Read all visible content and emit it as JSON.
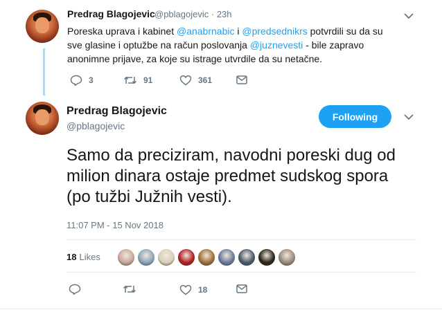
{
  "tweet1": {
    "name": "Predrag Blagojevic",
    "handle": "@pblagojevic",
    "time": "· 23h",
    "text_parts": [
      {
        "text": "Poreska uprava i kabinet ",
        "mention": false
      },
      {
        "text": "@anabrnabic",
        "mention": true
      },
      {
        "text": " i ",
        "mention": false
      },
      {
        "text": "@predsednikrs",
        "mention": true
      },
      {
        "text": " potvrdili su da su sve glasine i optužbe na račun poslovanja ",
        "mention": false
      },
      {
        "text": "@juznevesti",
        "mention": true
      },
      {
        "text": " - bile zapravo anonimne prijave, za koje su istrage utvrdile da su netačne.",
        "mention": false
      }
    ],
    "actions": {
      "replies": "3",
      "retweets": "91",
      "likes": "361"
    }
  },
  "tweet2": {
    "name": "Predrag Blagojevic",
    "handle": "@pblagojevic",
    "follow_label": "Following",
    "text": "Samo da preciziram, navodni poreski dug od milion dinara ostaje predmet sudskog spora (po tužbi Južnih vesti).",
    "timestamp": "11:07 PM - 15 Nov 2018",
    "likes_count": "18",
    "likes_label": "Likes",
    "likers": [
      {
        "name": "liker-avatar",
        "color": "#c9a89a"
      },
      {
        "name": "liker-avatar",
        "color": "#8aa7b8"
      },
      {
        "name": "liker-avatar",
        "color": "#d8d0b8"
      },
      {
        "name": "liker-avatar",
        "color": "#b02020"
      },
      {
        "name": "liker-avatar",
        "color": "#a0703a"
      },
      {
        "name": "liker-avatar",
        "color": "#6a7a9a"
      },
      {
        "name": "liker-avatar",
        "color": "#4a5a6a"
      },
      {
        "name": "liker-avatar",
        "color": "#2a2418"
      },
      {
        "name": "liker-avatar",
        "color": "#9a8a7a"
      }
    ],
    "actions": {
      "replies": "",
      "retweets": "",
      "likes": "18"
    }
  },
  "colors": {
    "accent": "#1da1f2",
    "muted": "#657786",
    "text": "#14171a"
  }
}
